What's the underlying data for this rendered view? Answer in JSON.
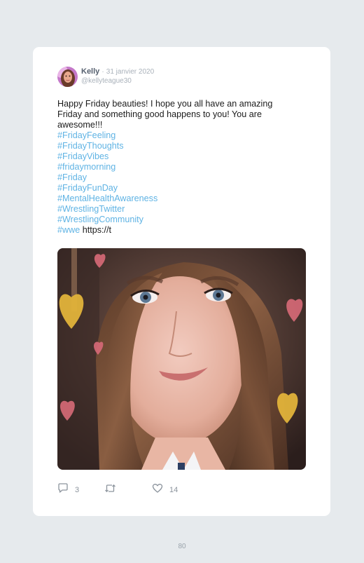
{
  "tweet": {
    "author_name": "Kelly",
    "separator": "·",
    "date": "31 janvier 2020",
    "handle": "@kellyteague30",
    "text_lines": [
      "Happy Friday beauties! I hope you all have an amazing",
      "Friday and something good happens to you! You are",
      "awesome!!!"
    ],
    "hashtags": [
      "#FridayFeeling",
      "#FridayThoughts",
      "#FridayVibes",
      "#fridaymorning",
      "#Friday",
      "#FridayFunDay",
      "#MentalHealthAwareness",
      "#WrestlingTwitter",
      "#WrestlingCommunity",
      "#wwe"
    ],
    "link": "https://t"
  },
  "actions": {
    "reply_count": "3",
    "retweet_count": "",
    "like_count": "14"
  },
  "page_number": "80",
  "colors": {
    "background": "#e6eaed",
    "card": "#ffffff",
    "hashtag": "#5fb3e4",
    "meta": "#a9b1ba",
    "icon": "#8c949d"
  },
  "icons": {
    "reply": "speech-bubble",
    "retweet": "loop-arrows",
    "like": "heart"
  }
}
